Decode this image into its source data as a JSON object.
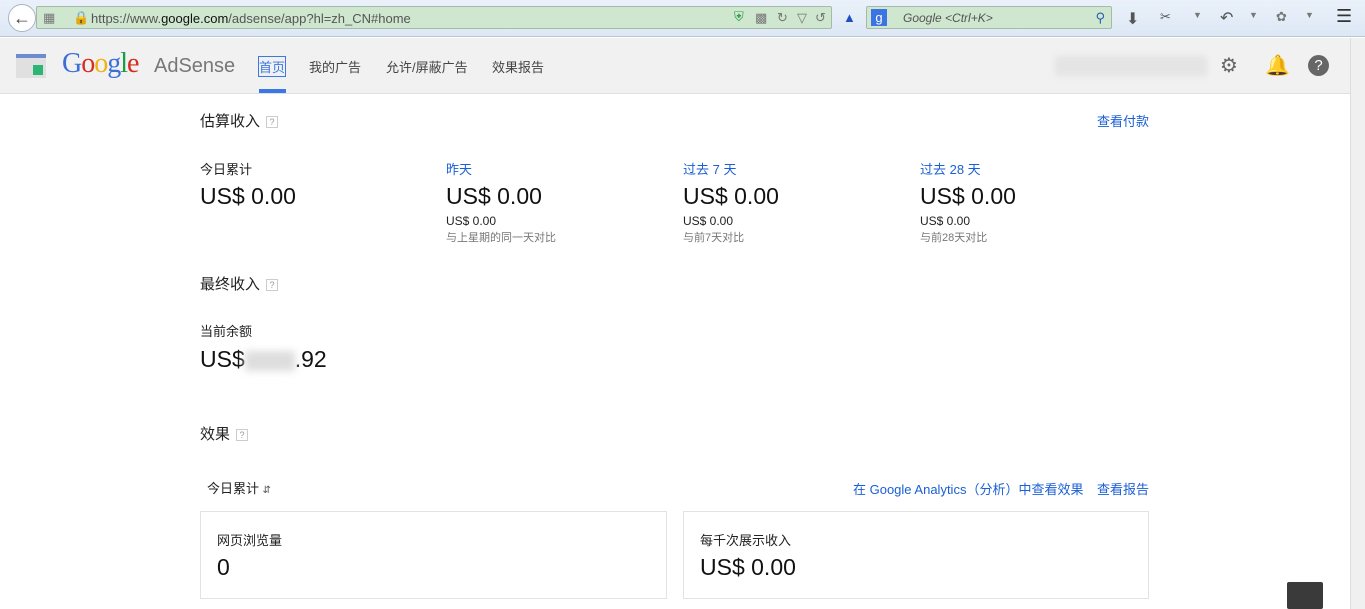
{
  "browser": {
    "url_prefix": "https://www.",
    "url_domain": "google.com",
    "url_suffix": "/adsense/app?hl=zh_CN#home",
    "search_placeholder": "Google <Ctrl+K>"
  },
  "header": {
    "logo": "Google",
    "product": "AdSense",
    "nav": [
      {
        "label": "首页",
        "active": true
      },
      {
        "label": "我的广告"
      },
      {
        "label": "允许/屏蔽广告"
      },
      {
        "label": "效果报告"
      }
    ]
  },
  "estimated": {
    "title": "估算收入",
    "help": "?",
    "payments_link": "查看付款",
    "columns": [
      {
        "label": "今日累计",
        "value": "US$ 0.00"
      },
      {
        "label": "昨天",
        "value": "US$ 0.00",
        "compare_value": "US$ 0.00",
        "compare_label": "与上星期的同一天对比"
      },
      {
        "label": "过去 7 天",
        "value": "US$ 0.00",
        "compare_value": "US$ 0.00",
        "compare_label": "与前7天对比"
      },
      {
        "label": "过去 28 天",
        "value": "US$ 0.00",
        "compare_value": "US$ 0.00",
        "compare_label": "与前28天对比"
      }
    ]
  },
  "finalized": {
    "title": "最终收入",
    "help": "?",
    "balance_label": "当前余额",
    "balance_prefix": "US$",
    "balance_suffix": ".92"
  },
  "performance": {
    "title": "效果",
    "help": "?",
    "period": "今日累计",
    "analytics_link": "在 Google Analytics（分析）中查看效果",
    "report_link": "查看报告",
    "cards": [
      {
        "label": "网页浏览量",
        "value": "0"
      },
      {
        "label": "每千次展示收入",
        "value": "US$ 0.00"
      }
    ]
  }
}
